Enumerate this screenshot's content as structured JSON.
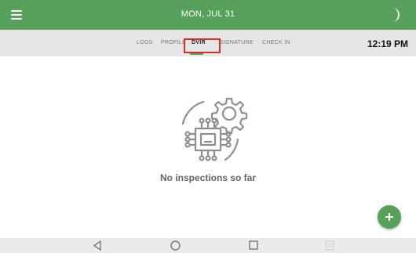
{
  "header": {
    "date": "MON, JUL 31",
    "menu_icon": "hamburger-menu-icon",
    "theme_icon": "moon-icon",
    "color": "#57a15c"
  },
  "tabs": [
    {
      "label": "LOGS",
      "active": false
    },
    {
      "label": "PROFILE",
      "active": false
    },
    {
      "label": "DVIR",
      "active": true
    },
    {
      "label": "SIGNATURE",
      "active": false
    },
    {
      "label": "CHECK IN",
      "active": false
    }
  ],
  "time": "12:19 PM",
  "empty_state": {
    "icon": "circuit-gear-icon",
    "message": "No inspections so far"
  },
  "fab": {
    "icon": "plus-icon",
    "color": "#57a15c"
  },
  "navigation_bar": {
    "icons": [
      "back-icon",
      "home-icon",
      "recents-icon",
      "keyboard-icon"
    ]
  }
}
